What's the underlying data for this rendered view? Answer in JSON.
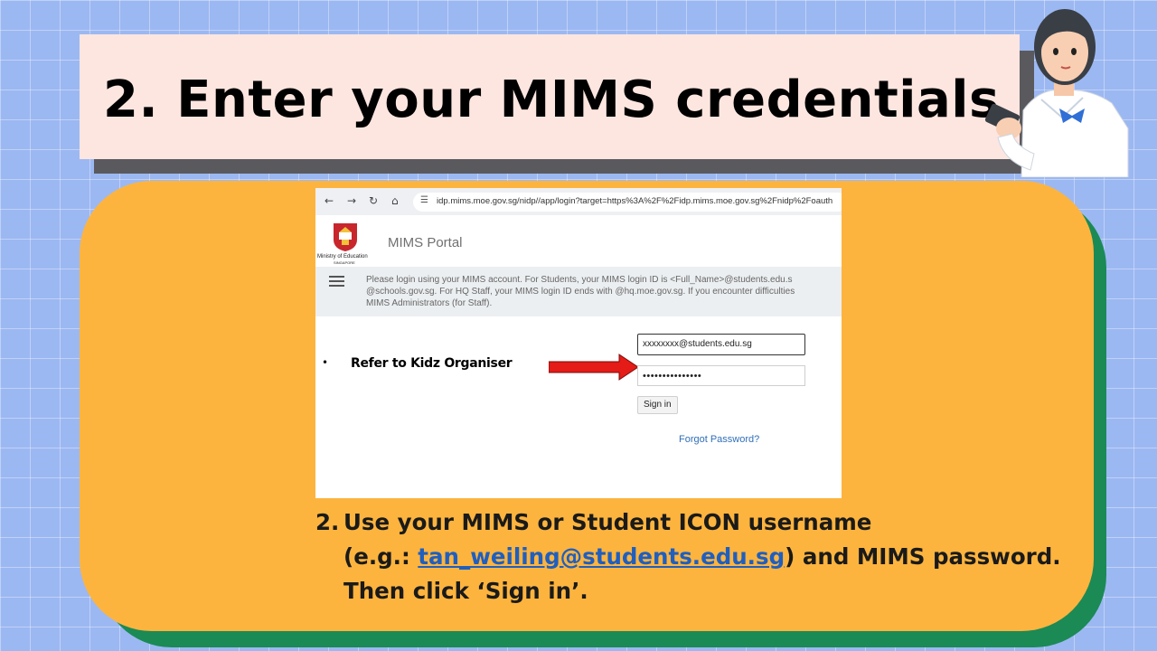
{
  "slide": {
    "title": "2. Enter your MIMS credentials"
  },
  "browser": {
    "url": "idp.mims.moe.gov.sg/nidp//app/login?target=https%3A%2F%2Fidp.mims.moe.gov.sg%2Fnidp%2Foauth",
    "nav_icons": [
      "back-icon",
      "forward-icon",
      "reload-icon",
      "home-icon",
      "site-info-icon"
    ]
  },
  "portal": {
    "org_name": "Ministry of Education",
    "org_sub": "SINGAPORE",
    "name": "MIMS Portal",
    "notice_lines": [
      "Please login using your MIMS account. For Students, your MIMS login ID is <Full_Name>@students.edu.s",
      "@schools.gov.sg. For HQ Staff, your MIMS login ID ends with @hq.moe.gov.sg. If you encounter difficulties",
      "MIMS Administrators (for Staff)."
    ]
  },
  "login": {
    "username_value": "xxxxxxxx@students.edu.sg",
    "password_value": "•••••••••••••••",
    "sign_in_label": "Sign in",
    "forgot_label": "Forgot Password?"
  },
  "callout": {
    "bullet": "•",
    "text": "Refer to Kidz Organiser",
    "arrow_color": "#e41b17"
  },
  "instructions": {
    "number": "2.",
    "line1": "Use your MIMS or Student ICON username",
    "line2_prefix": "(e.g.: ",
    "line2_link": "tan_weiling@students.edu.sg",
    "line2_suffix": ") and MIMS password.",
    "line3": "Then click ‘Sign in’."
  },
  "colors": {
    "background": "#9cb8f2",
    "banner": "#fde6e0",
    "card": "#fdb43e",
    "card_shadow": "#1b8a55",
    "link": "#1f5fbf"
  }
}
